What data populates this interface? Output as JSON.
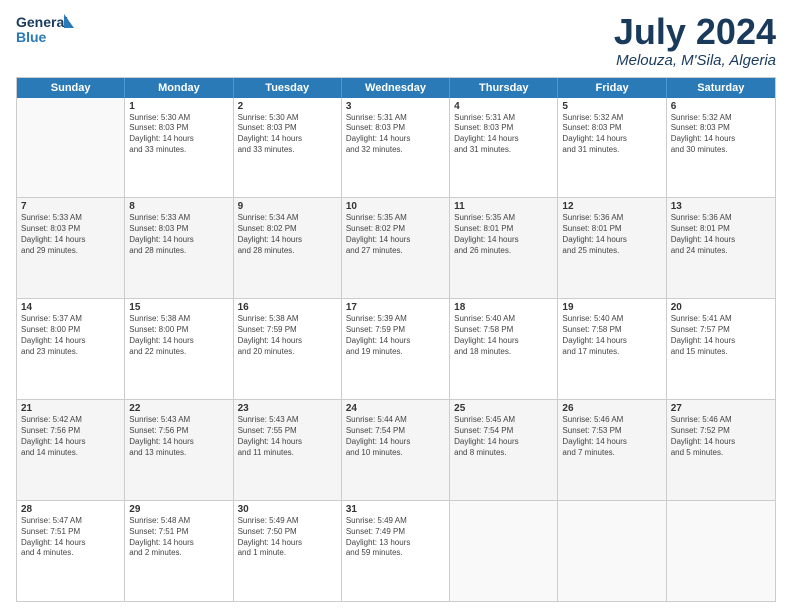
{
  "header": {
    "logo_line1": "General",
    "logo_line2": "Blue",
    "month": "July 2024",
    "location": "Melouza, M'Sila, Algeria"
  },
  "weekdays": [
    "Sunday",
    "Monday",
    "Tuesday",
    "Wednesday",
    "Thursday",
    "Friday",
    "Saturday"
  ],
  "rows": [
    [
      {
        "day": "",
        "text": ""
      },
      {
        "day": "1",
        "text": "Sunrise: 5:30 AM\nSunset: 8:03 PM\nDaylight: 14 hours\nand 33 minutes."
      },
      {
        "day": "2",
        "text": "Sunrise: 5:30 AM\nSunset: 8:03 PM\nDaylight: 14 hours\nand 33 minutes."
      },
      {
        "day": "3",
        "text": "Sunrise: 5:31 AM\nSunset: 8:03 PM\nDaylight: 14 hours\nand 32 minutes."
      },
      {
        "day": "4",
        "text": "Sunrise: 5:31 AM\nSunset: 8:03 PM\nDaylight: 14 hours\nand 31 minutes."
      },
      {
        "day": "5",
        "text": "Sunrise: 5:32 AM\nSunset: 8:03 PM\nDaylight: 14 hours\nand 31 minutes."
      },
      {
        "day": "6",
        "text": "Sunrise: 5:32 AM\nSunset: 8:03 PM\nDaylight: 14 hours\nand 30 minutes."
      }
    ],
    [
      {
        "day": "7",
        "text": "Sunrise: 5:33 AM\nSunset: 8:03 PM\nDaylight: 14 hours\nand 29 minutes."
      },
      {
        "day": "8",
        "text": "Sunrise: 5:33 AM\nSunset: 8:03 PM\nDaylight: 14 hours\nand 28 minutes."
      },
      {
        "day": "9",
        "text": "Sunrise: 5:34 AM\nSunset: 8:02 PM\nDaylight: 14 hours\nand 28 minutes."
      },
      {
        "day": "10",
        "text": "Sunrise: 5:35 AM\nSunset: 8:02 PM\nDaylight: 14 hours\nand 27 minutes."
      },
      {
        "day": "11",
        "text": "Sunrise: 5:35 AM\nSunset: 8:01 PM\nDaylight: 14 hours\nand 26 minutes."
      },
      {
        "day": "12",
        "text": "Sunrise: 5:36 AM\nSunset: 8:01 PM\nDaylight: 14 hours\nand 25 minutes."
      },
      {
        "day": "13",
        "text": "Sunrise: 5:36 AM\nSunset: 8:01 PM\nDaylight: 14 hours\nand 24 minutes."
      }
    ],
    [
      {
        "day": "14",
        "text": "Sunrise: 5:37 AM\nSunset: 8:00 PM\nDaylight: 14 hours\nand 23 minutes."
      },
      {
        "day": "15",
        "text": "Sunrise: 5:38 AM\nSunset: 8:00 PM\nDaylight: 14 hours\nand 22 minutes."
      },
      {
        "day": "16",
        "text": "Sunrise: 5:38 AM\nSunset: 7:59 PM\nDaylight: 14 hours\nand 20 minutes."
      },
      {
        "day": "17",
        "text": "Sunrise: 5:39 AM\nSunset: 7:59 PM\nDaylight: 14 hours\nand 19 minutes."
      },
      {
        "day": "18",
        "text": "Sunrise: 5:40 AM\nSunset: 7:58 PM\nDaylight: 14 hours\nand 18 minutes."
      },
      {
        "day": "19",
        "text": "Sunrise: 5:40 AM\nSunset: 7:58 PM\nDaylight: 14 hours\nand 17 minutes."
      },
      {
        "day": "20",
        "text": "Sunrise: 5:41 AM\nSunset: 7:57 PM\nDaylight: 14 hours\nand 15 minutes."
      }
    ],
    [
      {
        "day": "21",
        "text": "Sunrise: 5:42 AM\nSunset: 7:56 PM\nDaylight: 14 hours\nand 14 minutes."
      },
      {
        "day": "22",
        "text": "Sunrise: 5:43 AM\nSunset: 7:56 PM\nDaylight: 14 hours\nand 13 minutes."
      },
      {
        "day": "23",
        "text": "Sunrise: 5:43 AM\nSunset: 7:55 PM\nDaylight: 14 hours\nand 11 minutes."
      },
      {
        "day": "24",
        "text": "Sunrise: 5:44 AM\nSunset: 7:54 PM\nDaylight: 14 hours\nand 10 minutes."
      },
      {
        "day": "25",
        "text": "Sunrise: 5:45 AM\nSunset: 7:54 PM\nDaylight: 14 hours\nand 8 minutes."
      },
      {
        "day": "26",
        "text": "Sunrise: 5:46 AM\nSunset: 7:53 PM\nDaylight: 14 hours\nand 7 minutes."
      },
      {
        "day": "27",
        "text": "Sunrise: 5:46 AM\nSunset: 7:52 PM\nDaylight: 14 hours\nand 5 minutes."
      }
    ],
    [
      {
        "day": "28",
        "text": "Sunrise: 5:47 AM\nSunset: 7:51 PM\nDaylight: 14 hours\nand 4 minutes."
      },
      {
        "day": "29",
        "text": "Sunrise: 5:48 AM\nSunset: 7:51 PM\nDaylight: 14 hours\nand 2 minutes."
      },
      {
        "day": "30",
        "text": "Sunrise: 5:49 AM\nSunset: 7:50 PM\nDaylight: 14 hours\nand 1 minute."
      },
      {
        "day": "31",
        "text": "Sunrise: 5:49 AM\nSunset: 7:49 PM\nDaylight: 13 hours\nand 59 minutes."
      },
      {
        "day": "",
        "text": ""
      },
      {
        "day": "",
        "text": ""
      },
      {
        "day": "",
        "text": ""
      }
    ]
  ]
}
